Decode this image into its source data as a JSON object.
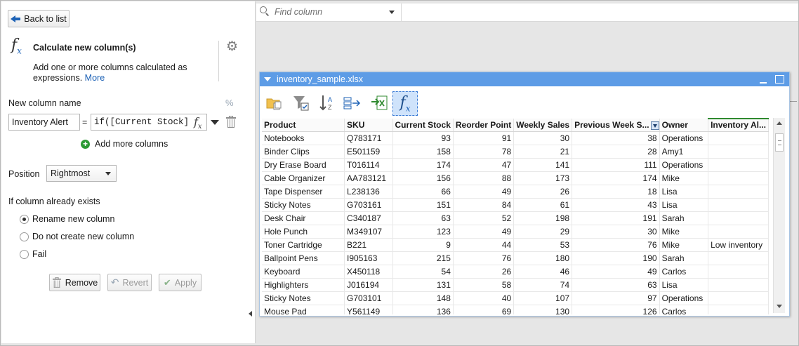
{
  "left_panel": {
    "back_label": "Back to list",
    "title": "Calculate new column(s)",
    "description": "Add one or more columns calculated as expressions.",
    "more_link": "More",
    "new_column_label": "New column name",
    "column_name_value": "Inventory Alert",
    "equals": "=",
    "expression_value": "if([Current Stock]",
    "add_more_label": "Add more columns",
    "position_label": "Position",
    "position_value": "Rightmost",
    "exists_label": "If column already exists",
    "options": [
      {
        "label": "Rename new column",
        "selected": true
      },
      {
        "label": "Do not create new column",
        "selected": false
      },
      {
        "label": "Fail",
        "selected": false
      }
    ],
    "remove_label": "Remove",
    "revert_label": "Revert",
    "apply_label": "Apply"
  },
  "find_bar": {
    "placeholder": "Find column"
  },
  "dataset": {
    "title": "inventory_sample.xlsx",
    "columns": [
      "Product",
      "SKU",
      "Current Stock",
      "Reorder Point",
      "Weekly Sales",
      "Previous Week S...",
      "Owner",
      "Inventory Al..."
    ],
    "rows": [
      [
        "Notebooks",
        "Q783171",
        "93",
        "91",
        "30",
        "38",
        "Operations",
        ""
      ],
      [
        "Binder Clips",
        "E501159",
        "158",
        "78",
        "21",
        "28",
        "Amy1",
        ""
      ],
      [
        "Dry Erase Board",
        "T016114",
        "174",
        "47",
        "141",
        "111",
        "Operations",
        ""
      ],
      [
        "Cable Organizer",
        "AA783121",
        "156",
        "88",
        "173",
        "174",
        "Mike",
        ""
      ],
      [
        "Tape Dispenser",
        "L238136",
        "66",
        "49",
        "26",
        "18",
        "Lisa",
        ""
      ],
      [
        "Sticky Notes",
        "G703161",
        "151",
        "84",
        "61",
        "43",
        "Lisa",
        ""
      ],
      [
        "Desk Chair",
        "C340187",
        "63",
        "52",
        "198",
        "191",
        "Sarah",
        ""
      ],
      [
        "Hole Punch",
        "M349107",
        "123",
        "49",
        "29",
        "30",
        "Mike",
        ""
      ],
      [
        "Toner Cartridge",
        "B221",
        "9",
        "44",
        "53",
        "76",
        "Mike",
        "Low inventory"
      ],
      [
        "Ballpoint Pens",
        "I905163",
        "215",
        "76",
        "180",
        "190",
        "Sarah",
        ""
      ],
      [
        "Keyboard",
        "X450118",
        "54",
        "26",
        "46",
        "49",
        "Carlos",
        ""
      ],
      [
        "Highlighters",
        "J016194",
        "131",
        "58",
        "74",
        "63",
        "Lisa",
        ""
      ],
      [
        "Sticky Notes",
        "G703101",
        "148",
        "40",
        "107",
        "97",
        "Operations",
        ""
      ],
      [
        "Mouse Pad",
        "Y561149",
        "136",
        "69",
        "130",
        "126",
        "Carlos",
        ""
      ]
    ]
  },
  "colors": {
    "accent": "#1d62b6",
    "titlebar": "#5d9ce6",
    "new_column_marker": "#2f8a2f"
  }
}
